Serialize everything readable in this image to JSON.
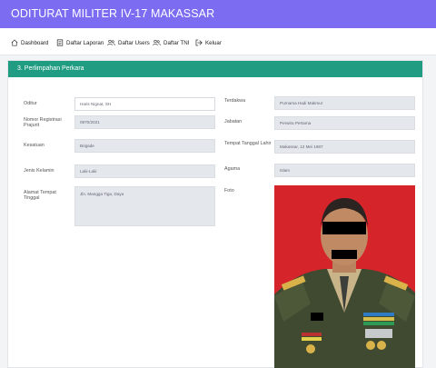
{
  "app": {
    "title": "ODITURAT MILITER IV-17 MAKASSAR"
  },
  "nav": [
    {
      "label": "Dashboard",
      "icon": "home-icon"
    },
    {
      "label": "Daftar Laporan",
      "icon": "document-icon"
    },
    {
      "label": "Daftar Users",
      "icon": "users-icon"
    },
    {
      "label": "Daftar TNI",
      "icon": "users-icon"
    },
    {
      "label": "Keluar",
      "icon": "logout-icon"
    }
  ],
  "card": {
    "title": "3. Perlimpahan Perkara"
  },
  "form": {
    "oditur": {
      "label": "Oditur",
      "value": "Haris Nignat, SH"
    },
    "nrp": {
      "label": "Nomor Registrasi Prajurit",
      "value": "0970/2021"
    },
    "kesatuan": {
      "label": "Kesatuan",
      "value": "Brigade"
    },
    "jenis_kelamin": {
      "label": "Jenis Kelamin",
      "value": "Laki-Laki"
    },
    "alamat": {
      "label": "Alamat Tempat Tinggal",
      "value": "Jln. Mangga Tiga, Daya"
    },
    "terdakwa": {
      "label": "Terdakwa",
      "value": "Purnama Hadi Makmur"
    },
    "jabatan": {
      "label": "Jabatan",
      "value": "Perwira Pertama"
    },
    "ttl": {
      "label": "Tempat Tanggal Lahir",
      "value": "Makassar, 12 Mei 1987"
    },
    "agama": {
      "label": "Agama",
      "value": "Islam"
    },
    "foto": {
      "label": "Foto"
    }
  },
  "colors": {
    "topbar": "#7b6cf2",
    "card_header": "#1f9c82",
    "photo_bg": "#d5252b"
  }
}
